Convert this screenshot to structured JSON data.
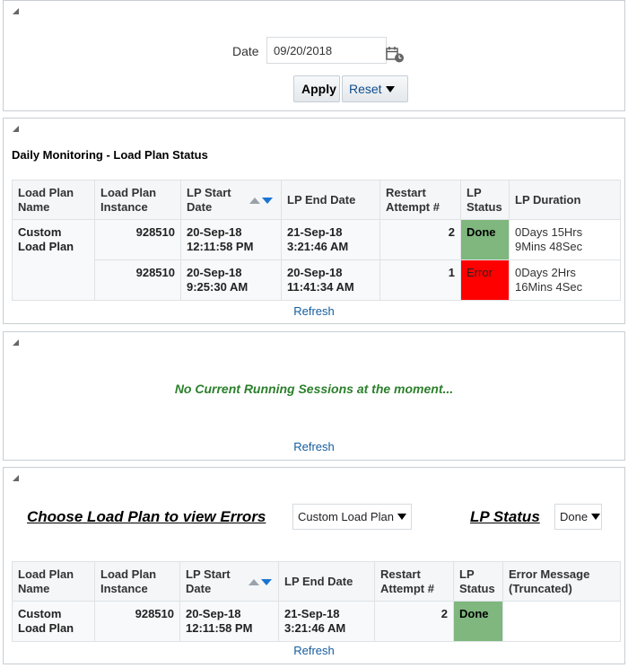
{
  "filter": {
    "date_label": "Date",
    "date_value": "09/20/2018",
    "apply_label": "Apply",
    "reset_label": "Reset"
  },
  "load_plan_status": {
    "title": "Daily Monitoring - Load Plan Status",
    "headers": [
      "Load Plan Name",
      "Load Plan Instance",
      "LP Start Date",
      "LP End Date",
      "Restart Attempt #",
      "LP Status",
      "LP Duration"
    ],
    "plan_name": "Custom Load Plan",
    "rows": [
      {
        "instance": "928510",
        "start": "20-Sep-18 12:11:58 PM",
        "end": "21-Sep-18 3:21:46 AM",
        "restart": "2",
        "status": "Done",
        "duration": "0Days 15Hrs 9Mins 48Sec"
      },
      {
        "instance": "928510",
        "start": "20-Sep-18 9:25:30 AM",
        "end": "20-Sep-18 11:41:34 AM",
        "restart": "1",
        "status": "Error",
        "duration": "0Days 2Hrs 16Mins 4Sec"
      }
    ],
    "refresh_label": "Refresh"
  },
  "running_sessions": {
    "message": "No Current Running Sessions at the moment...",
    "refresh_label": "Refresh"
  },
  "errors": {
    "choose_label": "Choose Load Plan to view Errors",
    "load_plan_selected": "Custom Load Plan",
    "status_label": "LP Status",
    "status_selected": "Done",
    "headers": [
      "Load Plan Name",
      "Load Plan Instance",
      "LP Start Date",
      "LP End Date",
      "Restart Attempt #",
      "LP Status",
      "Error Message (Truncated)"
    ],
    "rows": [
      {
        "plan_name": "Custom Load Plan",
        "instance": "928510",
        "start": "20-Sep-18 12:11:58 PM",
        "end": "21-Sep-18 3:21:46 AM",
        "restart": "2",
        "status": "Done",
        "error": ""
      }
    ],
    "refresh_label": "Refresh"
  },
  "colors": {
    "done": "#7fb77e",
    "error": "#ff0000",
    "link": "#145c9e",
    "message": "#2b7f2b"
  }
}
